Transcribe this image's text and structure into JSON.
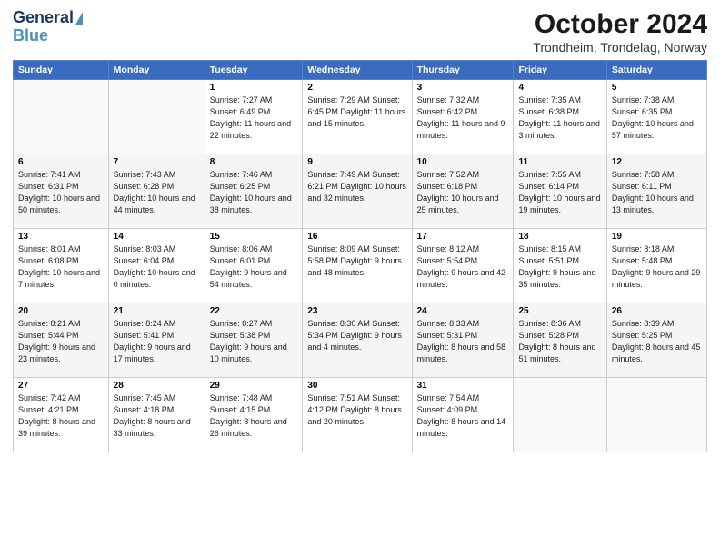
{
  "logo": {
    "line1": "General",
    "line2": "Blue"
  },
  "title": "October 2024",
  "subtitle": "Trondheim, Trondelag, Norway",
  "headers": [
    "Sunday",
    "Monday",
    "Tuesday",
    "Wednesday",
    "Thursday",
    "Friday",
    "Saturday"
  ],
  "weeks": [
    [
      {
        "day": "",
        "info": ""
      },
      {
        "day": "",
        "info": ""
      },
      {
        "day": "1",
        "info": "Sunrise: 7:27 AM\nSunset: 6:49 PM\nDaylight: 11 hours\nand 22 minutes."
      },
      {
        "day": "2",
        "info": "Sunrise: 7:29 AM\nSunset: 6:45 PM\nDaylight: 11 hours\nand 15 minutes."
      },
      {
        "day": "3",
        "info": "Sunrise: 7:32 AM\nSunset: 6:42 PM\nDaylight: 11 hours\nand 9 minutes."
      },
      {
        "day": "4",
        "info": "Sunrise: 7:35 AM\nSunset: 6:38 PM\nDaylight: 11 hours\nand 3 minutes."
      },
      {
        "day": "5",
        "info": "Sunrise: 7:38 AM\nSunset: 6:35 PM\nDaylight: 10 hours\nand 57 minutes."
      }
    ],
    [
      {
        "day": "6",
        "info": "Sunrise: 7:41 AM\nSunset: 6:31 PM\nDaylight: 10 hours\nand 50 minutes."
      },
      {
        "day": "7",
        "info": "Sunrise: 7:43 AM\nSunset: 6:28 PM\nDaylight: 10 hours\nand 44 minutes."
      },
      {
        "day": "8",
        "info": "Sunrise: 7:46 AM\nSunset: 6:25 PM\nDaylight: 10 hours\nand 38 minutes."
      },
      {
        "day": "9",
        "info": "Sunrise: 7:49 AM\nSunset: 6:21 PM\nDaylight: 10 hours\nand 32 minutes."
      },
      {
        "day": "10",
        "info": "Sunrise: 7:52 AM\nSunset: 6:18 PM\nDaylight: 10 hours\nand 25 minutes."
      },
      {
        "day": "11",
        "info": "Sunrise: 7:55 AM\nSunset: 6:14 PM\nDaylight: 10 hours\nand 19 minutes."
      },
      {
        "day": "12",
        "info": "Sunrise: 7:58 AM\nSunset: 6:11 PM\nDaylight: 10 hours\nand 13 minutes."
      }
    ],
    [
      {
        "day": "13",
        "info": "Sunrise: 8:01 AM\nSunset: 6:08 PM\nDaylight: 10 hours\nand 7 minutes."
      },
      {
        "day": "14",
        "info": "Sunrise: 8:03 AM\nSunset: 6:04 PM\nDaylight: 10 hours\nand 0 minutes."
      },
      {
        "day": "15",
        "info": "Sunrise: 8:06 AM\nSunset: 6:01 PM\nDaylight: 9 hours\nand 54 minutes."
      },
      {
        "day": "16",
        "info": "Sunrise: 8:09 AM\nSunset: 5:58 PM\nDaylight: 9 hours\nand 48 minutes."
      },
      {
        "day": "17",
        "info": "Sunrise: 8:12 AM\nSunset: 5:54 PM\nDaylight: 9 hours\nand 42 minutes."
      },
      {
        "day": "18",
        "info": "Sunrise: 8:15 AM\nSunset: 5:51 PM\nDaylight: 9 hours\nand 35 minutes."
      },
      {
        "day": "19",
        "info": "Sunrise: 8:18 AM\nSunset: 5:48 PM\nDaylight: 9 hours\nand 29 minutes."
      }
    ],
    [
      {
        "day": "20",
        "info": "Sunrise: 8:21 AM\nSunset: 5:44 PM\nDaylight: 9 hours\nand 23 minutes."
      },
      {
        "day": "21",
        "info": "Sunrise: 8:24 AM\nSunset: 5:41 PM\nDaylight: 9 hours\nand 17 minutes."
      },
      {
        "day": "22",
        "info": "Sunrise: 8:27 AM\nSunset: 5:38 PM\nDaylight: 9 hours\nand 10 minutes."
      },
      {
        "day": "23",
        "info": "Sunrise: 8:30 AM\nSunset: 5:34 PM\nDaylight: 9 hours\nand 4 minutes."
      },
      {
        "day": "24",
        "info": "Sunrise: 8:33 AM\nSunset: 5:31 PM\nDaylight: 8 hours\nand 58 minutes."
      },
      {
        "day": "25",
        "info": "Sunrise: 8:36 AM\nSunset: 5:28 PM\nDaylight: 8 hours\nand 51 minutes."
      },
      {
        "day": "26",
        "info": "Sunrise: 8:39 AM\nSunset: 5:25 PM\nDaylight: 8 hours\nand 45 minutes."
      }
    ],
    [
      {
        "day": "27",
        "info": "Sunrise: 7:42 AM\nSunset: 4:21 PM\nDaylight: 8 hours\nand 39 minutes."
      },
      {
        "day": "28",
        "info": "Sunrise: 7:45 AM\nSunset: 4:18 PM\nDaylight: 8 hours\nand 33 minutes."
      },
      {
        "day": "29",
        "info": "Sunrise: 7:48 AM\nSunset: 4:15 PM\nDaylight: 8 hours\nand 26 minutes."
      },
      {
        "day": "30",
        "info": "Sunrise: 7:51 AM\nSunset: 4:12 PM\nDaylight: 8 hours\nand 20 minutes."
      },
      {
        "day": "31",
        "info": "Sunrise: 7:54 AM\nSunset: 4:09 PM\nDaylight: 8 hours\nand 14 minutes."
      },
      {
        "day": "",
        "info": ""
      },
      {
        "day": "",
        "info": ""
      }
    ]
  ]
}
